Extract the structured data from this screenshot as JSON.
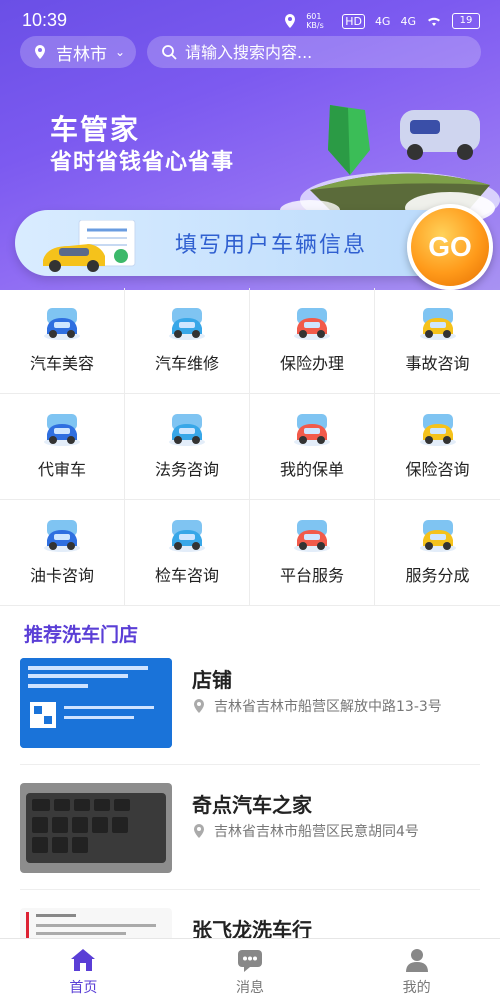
{
  "status_bar": {
    "time": "10:39",
    "net": "601 KB/s",
    "hd": "HD",
    "sig1": "4G",
    "sig2": "4G",
    "battery": "19"
  },
  "header": {
    "city": "吉林市",
    "search_placeholder": "请输入搜索内容..."
  },
  "banner": {
    "title": "车管家",
    "subtitle": "省时省钱省心省事",
    "cta_text": "填写用户车辆信息",
    "go_label": "GO"
  },
  "services": [
    {
      "label": "汽车美容",
      "icon": "car-wash-icon"
    },
    {
      "label": "汽车维修",
      "icon": "car-repair-icon"
    },
    {
      "label": "保险办理",
      "icon": "insurance-icon"
    },
    {
      "label": "事故咨询",
      "icon": "accident-consult-icon"
    },
    {
      "label": "代审车",
      "icon": "car-inspection-agent-icon"
    },
    {
      "label": "法务咨询",
      "icon": "legal-consult-icon"
    },
    {
      "label": "我的保单",
      "icon": "policy-icon"
    },
    {
      "label": "保险咨询",
      "icon": "insurance-consult-icon"
    },
    {
      "label": "油卡咨询",
      "icon": "fuel-card-icon"
    },
    {
      "label": "检车咨询",
      "icon": "vehicle-check-icon"
    },
    {
      "label": "平台服务",
      "icon": "platform-service-icon"
    },
    {
      "label": "服务分成",
      "icon": "service-share-icon"
    }
  ],
  "recommend": {
    "title": "推荐洗车门店",
    "shops": [
      {
        "name": "店铺",
        "address": "吉林省吉林市船营区解放中路13-3号"
      },
      {
        "name": "奇点汽车之家",
        "address": "吉林省吉林市船营区民意胡同4号"
      },
      {
        "name": "张飞龙洗车行",
        "address": ""
      }
    ]
  },
  "tabs": [
    {
      "label": "首页",
      "icon": "home-icon",
      "active": true
    },
    {
      "label": "消息",
      "icon": "message-icon",
      "active": false
    },
    {
      "label": "我的",
      "icon": "profile-icon",
      "active": false
    }
  ],
  "colors": {
    "accent": "#5a3ed6",
    "hero": "#7c5af0",
    "go": "#ff9a1a"
  }
}
